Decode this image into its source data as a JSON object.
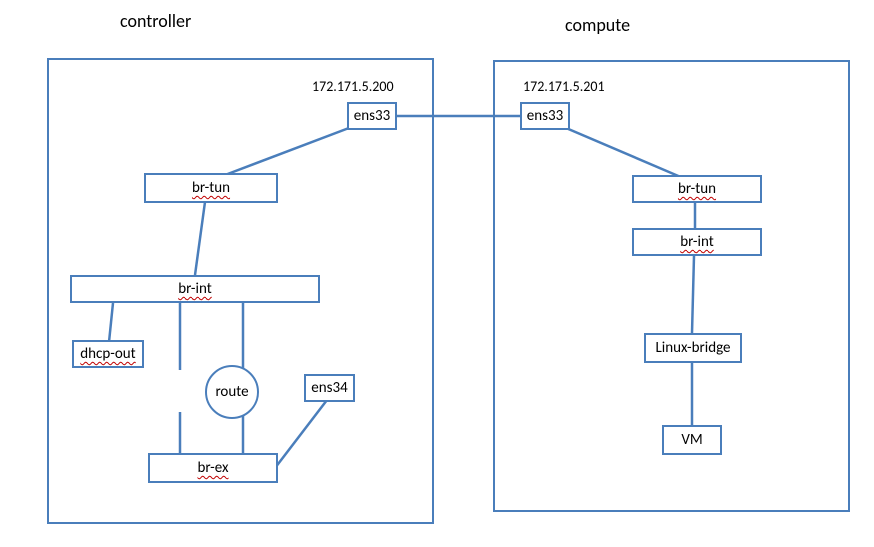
{
  "titles": {
    "controller": "controller",
    "compute": "compute"
  },
  "ips": {
    "controller": "172.171.5.200",
    "compute": "172.171.5.201"
  },
  "controller": {
    "ens33": "ens33",
    "br_tun": "br-tun",
    "br_int": "br-int",
    "dhcp_out": "dhcp-out",
    "route": "route",
    "ens34": "ens34",
    "br_ex": "br-ex"
  },
  "compute": {
    "ens33": "ens33",
    "br_tun": "br-tun",
    "br_int": "br-int",
    "linux_bridge": "Linux-bridge",
    "vm": "VM"
  },
  "colors": {
    "line": "#4a7ebb"
  }
}
